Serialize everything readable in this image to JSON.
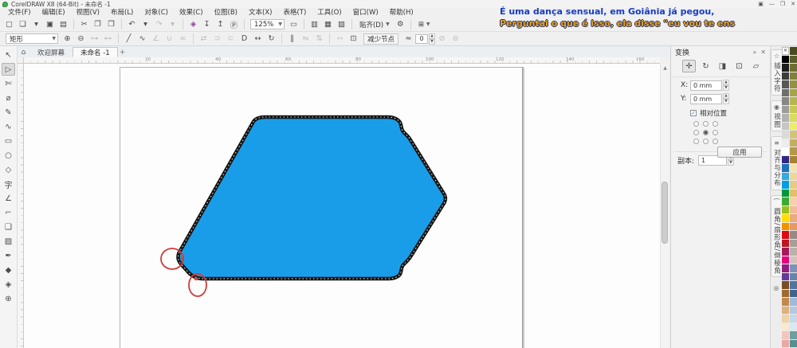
{
  "window": {
    "title": "CorelDRAW X8 (64-Bit) - 未命名 -1",
    "controls": [
      {
        "name": "account-button",
        "glyph": "▣"
      },
      {
        "name": "minimize-button",
        "glyph": "—"
      },
      {
        "name": "restore-button",
        "glyph": "❐"
      },
      {
        "name": "close-button",
        "glyph": "✕"
      }
    ]
  },
  "subtitles": {
    "line1": "É uma dança sensual, em Goiânia já pegou,",
    "line2": "Perguntai o que é isso, ela disse \"eu vou te ens",
    "line1_color": "#1d3db4",
    "line2_color": "#f2a31c"
  },
  "menu": {
    "items": [
      "文件(F)",
      "编辑(E)",
      "视图(V)",
      "布局(L)",
      "对象(C)",
      "效果(C)",
      "位图(B)",
      "文本(X)",
      "表格(T)",
      "工具(O)",
      "窗口(W)",
      "帮助(H)"
    ]
  },
  "toolbar": {
    "zoom_level": "125%",
    "snap_label": "贴齐(D)",
    "group_a": [
      {
        "name": "new-document-icon",
        "glyph": "▢"
      },
      {
        "name": "open-icon",
        "glyph": "❏"
      },
      {
        "name": "open-dropdown-icon",
        "glyph": "▾"
      },
      {
        "name": "save-icon",
        "glyph": "▣"
      },
      {
        "name": "print-icon",
        "glyph": "▤"
      },
      {
        "name": "separator",
        "sep": true
      },
      {
        "name": "cut-icon",
        "glyph": "✂"
      },
      {
        "name": "copy-icon",
        "glyph": "❐"
      },
      {
        "name": "paste-icon",
        "glyph": "❒"
      },
      {
        "name": "separator",
        "sep": true
      },
      {
        "name": "undo-icon",
        "glyph": "↶"
      },
      {
        "name": "undo-dropdown-icon",
        "glyph": "▾"
      },
      {
        "name": "redo-icon",
        "glyph": "↷",
        "disabled": true
      },
      {
        "name": "redo-dropdown-icon",
        "glyph": "▾",
        "disabled": true
      },
      {
        "name": "separator",
        "sep": true
      },
      {
        "name": "search-content-icon",
        "glyph": "◈",
        "color": "#8e3f97"
      },
      {
        "name": "import-icon",
        "glyph": "↧"
      },
      {
        "name": "export-icon",
        "glyph": "↥"
      },
      {
        "name": "publish-pdf-icon",
        "glyph": "Ⓟ"
      },
      {
        "name": "separator",
        "sep": true
      }
    ],
    "group_b": [
      {
        "name": "fullscreen-preview-icon",
        "glyph": "▭"
      },
      {
        "name": "separator",
        "sep": true
      },
      {
        "name": "show-rulers-icon",
        "glyph": "▥"
      },
      {
        "name": "show-grid-icon",
        "glyph": "▦"
      },
      {
        "name": "show-guidelines-icon",
        "glyph": "▧"
      },
      {
        "name": "separator",
        "sep": true
      }
    ],
    "options_icon": "⚙",
    "launcher_icon": "⊞"
  },
  "property_bar": {
    "selection_mode": "矩形",
    "reduce_nodes_label": "减少节点",
    "smoothness_glyph": "≈",
    "smoothness_value": "0",
    "icons": [
      {
        "name": "add-node-icon",
        "glyph": "⊕"
      },
      {
        "name": "delete-node-icon",
        "glyph": "⊖"
      },
      {
        "name": "join-nodes-icon",
        "glyph": "⊶",
        "disabled": true
      },
      {
        "name": "break-curve-icon",
        "glyph": "⊷",
        "disabled": true
      },
      {
        "name": "separator",
        "sep": true
      },
      {
        "name": "convert-to-line-icon",
        "glyph": "╱"
      },
      {
        "name": "convert-to-curve-icon",
        "glyph": "∿"
      },
      {
        "name": "cusp-node-icon",
        "glyph": "∠",
        "disabled": true
      },
      {
        "name": "smooth-node-icon",
        "glyph": "∪",
        "disabled": true
      },
      {
        "name": "symmetrical-node-icon",
        "glyph": "≍",
        "disabled": true
      },
      {
        "name": "separator",
        "sep": true
      },
      {
        "name": "reverse-direction-icon",
        "glyph": "⇄",
        "disabled": true
      },
      {
        "name": "extend-curve-icon",
        "glyph": "⊃",
        "disabled": true
      },
      {
        "name": "extract-subpath-icon",
        "glyph": "⊂",
        "disabled": true
      },
      {
        "name": "close-curve-icon",
        "glyph": "D"
      },
      {
        "name": "stretch-nodes-icon",
        "glyph": "↔"
      },
      {
        "name": "rotate-nodes-icon",
        "glyph": "↻"
      },
      {
        "name": "separator",
        "sep": true
      },
      {
        "name": "align-nodes-icon",
        "glyph": "∥"
      },
      {
        "name": "reflect-horizontal-icon",
        "glyph": "⇋",
        "disabled": true
      },
      {
        "name": "reflect-vertical-icon",
        "glyph": "⇅",
        "disabled": true
      },
      {
        "name": "separator",
        "sep": true
      },
      {
        "name": "elastic-mode-icon",
        "glyph": "∾",
        "disabled": true
      },
      {
        "name": "select-all-nodes-icon",
        "glyph": "⊡"
      }
    ],
    "trailing_icons": [
      {
        "name": "smooth-selection-icon",
        "glyph": "⊘",
        "disabled": true
      },
      {
        "name": "box-selection-icon",
        "glyph": "⊜",
        "disabled": true
      }
    ]
  },
  "document_tabs": {
    "home_glyph": "⌂",
    "tabs": [
      {
        "name": "tab-welcome-screen",
        "label": "欢迎屏幕"
      },
      {
        "name": "tab-untitled-1",
        "label": "未命名 -1",
        "active": true
      }
    ],
    "new_tab_glyph": "+"
  },
  "toolbox": {
    "tools": [
      {
        "name": "pick-tool",
        "glyph": "↖"
      },
      {
        "name": "shape-tool",
        "glyph": "▷",
        "active": true
      },
      {
        "name": "crop-tool",
        "glyph": "✄"
      },
      {
        "name": "zoom-tool",
        "glyph": "⌀"
      },
      {
        "name": "freehand-tool",
        "glyph": "✎"
      },
      {
        "name": "artistic-media-tool",
        "glyph": "∿"
      },
      {
        "name": "rectangle-tool",
        "glyph": "▭"
      },
      {
        "name": "ellipse-tool",
        "glyph": "○"
      },
      {
        "name": "polygon-tool",
        "glyph": "◇"
      },
      {
        "name": "text-tool",
        "glyph": "字"
      },
      {
        "name": "dimension-tool",
        "glyph": "∠"
      },
      {
        "name": "connector-tool",
        "glyph": "⌐"
      },
      {
        "name": "drop-shadow-tool",
        "glyph": "❑"
      },
      {
        "name": "transparency-tool",
        "glyph": "▨"
      },
      {
        "name": "color-eyedropper-tool",
        "glyph": "✒"
      },
      {
        "name": "interactive-fill-tool",
        "glyph": "◆"
      },
      {
        "name": "smart-fill-tool",
        "glyph": "◈"
      },
      {
        "name": "add-tools-button",
        "glyph": "⊕"
      }
    ]
  },
  "ruler": {
    "h_numbers": [
      "20",
      "40",
      "60",
      "80",
      "100",
      "120",
      "140",
      "160"
    ]
  },
  "canvas": {
    "shape": {
      "type": "rounded polygon arrow",
      "fill": "#1a9de8",
      "outline": "#141414"
    },
    "annotations": {
      "color": "#d03a3a"
    },
    "scrollbar_up_glyph": "▲"
  },
  "docker": {
    "title": "变换",
    "collapse_glyph": "»",
    "close_glyph": "✕",
    "transform_icons": [
      {
        "name": "position-transform-icon",
        "glyph": "✛",
        "active": true
      },
      {
        "name": "rotate-transform-icon",
        "glyph": "↻"
      },
      {
        "name": "scale-mirror-transform-icon",
        "glyph": "◨"
      },
      {
        "name": "size-transform-icon",
        "glyph": "⊡"
      },
      {
        "name": "skew-transform-icon",
        "glyph": "▱"
      }
    ],
    "x_label": "X:",
    "x_value": "0 mm",
    "y_label": "Y:",
    "y_value": "0 mm",
    "check_glyph": "✓",
    "relative_label": "相对位置",
    "copies_label": "副本:",
    "copies_value": "1",
    "apply_label": "应用"
  },
  "docker_tabs": {
    "tabs": [
      {
        "name": "docker-tab-insert-character",
        "glyph": "☆",
        "label": "插入字符"
      },
      {
        "name": "docker-tab-view",
        "glyph": "◉",
        "label": "视图"
      },
      {
        "name": "docker-tab-align-distribute",
        "glyph": "≡",
        "label": "对齐与分布"
      },
      {
        "name": "docker-tab-corners",
        "glyph": "⌒",
        "label": "圆角/扇形角/倒棱角"
      }
    ],
    "more_glyph": "⊕"
  },
  "palette": {
    "swatches": [
      "none",
      "#000000",
      "#1d1d1b",
      "#3c3c3b",
      "#575756",
      "#706f6f",
      "#878787",
      "#9d9d9c",
      "#b2b2b2",
      "#c6c6c6",
      "#dadada",
      "#ededed",
      "#ffffff",
      "#312783",
      "#1d71b8",
      "#36a9e1",
      "#009fe3",
      "#00983a",
      "#3aaa35",
      "#95c11f",
      "#ffde00",
      "#f39200",
      "#e30613",
      "#be1622",
      "#a3195b",
      "#e6007e",
      "#951b81",
      "#633b96",
      "#7d4e24",
      "#9d6b32",
      "#c18a4c",
      "#e0b079",
      "#f0d2a8",
      "#f9e9d2",
      "#f4c5c0",
      "#eaa9a4",
      "#4a4a20",
      "#5c5c28",
      "#6e6e30",
      "#808038",
      "#929240",
      "#a4a448",
      "#b6b650",
      "#c8c858",
      "#dada60",
      "#ecec68",
      "#d4c27a",
      "#c4ad62",
      "#b4984a",
      "#a48332",
      "#f4e3b2",
      "#eed79a",
      "#e8cb82",
      "#e2bf6a",
      "#f6cfae",
      "#f0bd96",
      "#eaab7e",
      "#e49966",
      "#958b84",
      "#a89e97",
      "#bbb1aa",
      "#cec4bd",
      "#7c93b5",
      "#6883a8",
      "#54739b",
      "#40638e",
      "#9fb9d8",
      "#b2c9e0",
      "#c5d9e8",
      "#d8e9f0",
      "#6aa0a0",
      "#568f8f"
    ]
  }
}
